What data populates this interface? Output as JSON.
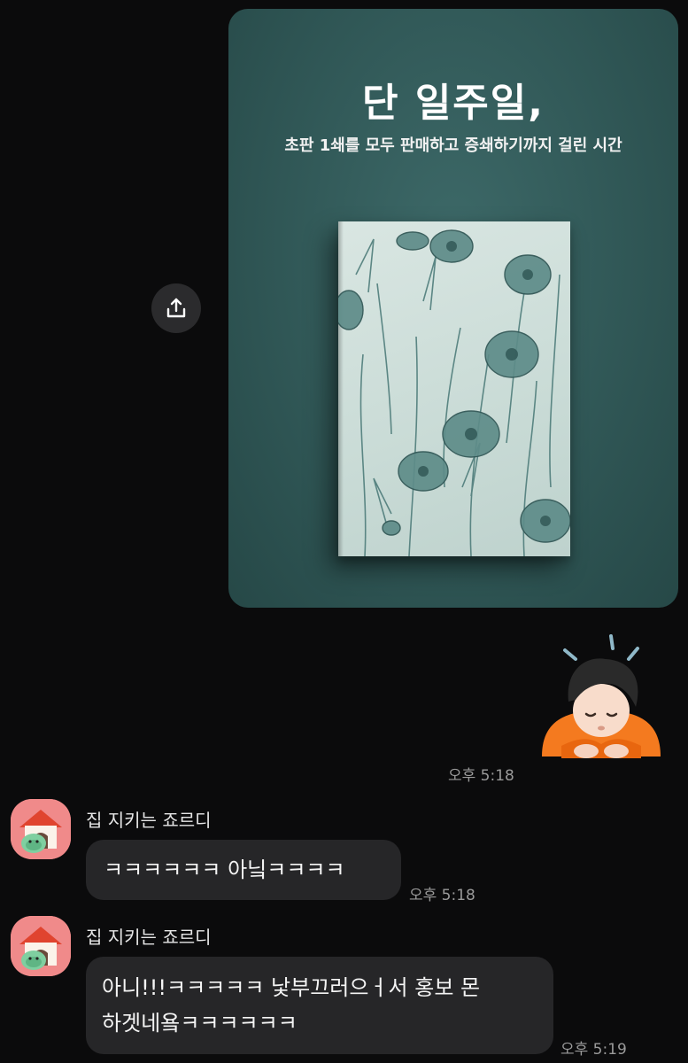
{
  "image_card": {
    "headline": "단 일주일,",
    "subline": "초판 1쇄를 모두 판매하고 증쇄하기까지 걸린 시간"
  },
  "sent_message": {
    "time": "오후 5:18"
  },
  "received_messages": [
    {
      "sender": "집 지키는 죠르디",
      "text": "ㅋㅋㅋㅋㅋㅋ 아닠ㅋㅋㅋㅋ",
      "time": "오후 5:18"
    },
    {
      "sender": "집 지키는 죠르디",
      "line1": "아니!!!ㅋㅋㅋㅋㅋ 낯부끄러으ㅓ서 홍보 몬",
      "line2": "하겟네욬ㅋㅋㅋㅋㅋㅋ",
      "time": "오후 5:19"
    }
  ],
  "icons": {
    "share": "share-upload-icon",
    "sticker": "bowing-person-sticker",
    "avatar": "doghouse-character-avatar"
  },
  "colors": {
    "background": "#0b0b0c",
    "card_teal": "#305756",
    "bubble": "#262628",
    "avatar_pink": "#f08a8a"
  }
}
